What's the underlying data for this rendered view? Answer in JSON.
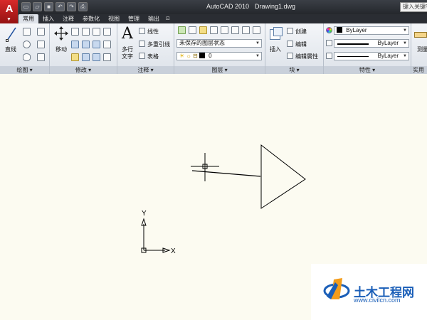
{
  "titlebar": {
    "app_title": "AutoCAD 2010",
    "document": "Drawing1.dwg",
    "search_placeholder": "键入关键字或",
    "qat_icons": [
      "new-icon",
      "open-icon",
      "save-icon",
      "undo-icon",
      "redo-icon",
      "plot-icon"
    ]
  },
  "tabs": [
    {
      "label": "常用",
      "active": true
    },
    {
      "label": "插入"
    },
    {
      "label": "注释"
    },
    {
      "label": "参数化"
    },
    {
      "label": "视图"
    },
    {
      "label": "管理"
    },
    {
      "label": "输出"
    }
  ],
  "panels": {
    "draw": {
      "title": "绘图 ▾",
      "line_label": "直线"
    },
    "modify": {
      "title": "修改 ▾",
      "move_label": "移动"
    },
    "annotation": {
      "title": "注释 ▾",
      "mtext_label_1": "多行",
      "mtext_label_2": "文字",
      "linear_label": "线性",
      "mleader_label": "多重引线",
      "table_label": "表格"
    },
    "layers": {
      "title": "图层 ▾",
      "layer_state": "未保存的图层状态",
      "current_layer": "0"
    },
    "block": {
      "title": "块 ▾",
      "insert_label": "插入",
      "create_label": "创建",
      "edit_label": "编辑",
      "edit_attr_label": "编辑属性"
    },
    "properties": {
      "title": "特性 ▾",
      "color": "ByLayer",
      "linetype": "ByLayer",
      "lineweight": "ByLayer"
    },
    "utilities": {
      "title": "实用工",
      "measure_label": "测量"
    }
  },
  "canvas": {
    "background": "#fcfbf1",
    "ucs_x_label": "X",
    "ucs_y_label": "Y"
  },
  "watermark": {
    "text": "土木工程网",
    "url": "www.civilcn.com"
  }
}
